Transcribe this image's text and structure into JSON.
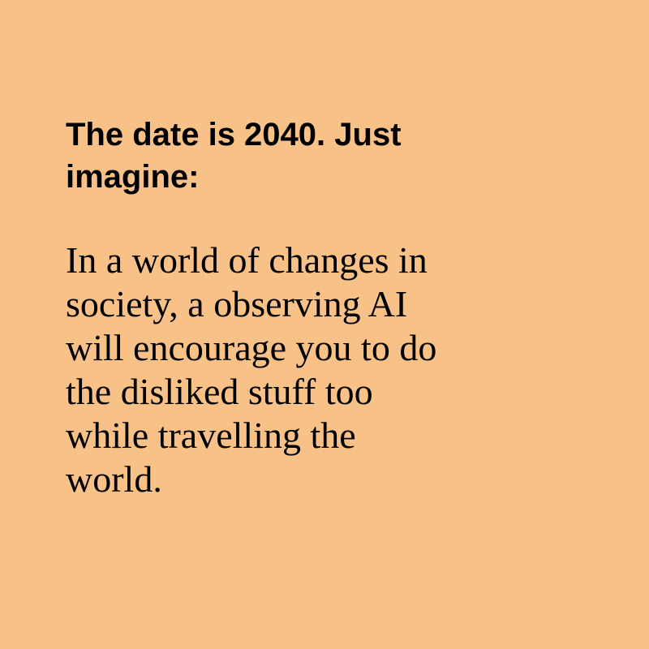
{
  "colors": {
    "background": "#F8C187",
    "text": "#000000"
  },
  "card": {
    "heading": "The date is 2040. Just\nimagine:",
    "body": "In a world of changes in\nsociety, a observing AI\nwill encourage you to do\nthe disliked stuff too\nwhile travelling the\nworld."
  }
}
